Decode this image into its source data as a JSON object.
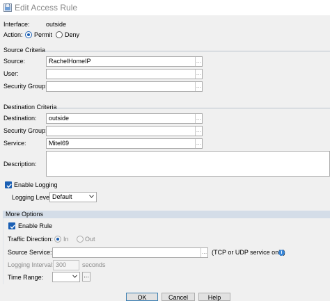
{
  "window": {
    "title": "Edit Access Rule",
    "app_icon": "asdm-shield-icon"
  },
  "interface": {
    "label": "Interface:",
    "value": "outside"
  },
  "action": {
    "label": "Action:",
    "options": [
      "Permit",
      "Deny"
    ],
    "selected": "Permit"
  },
  "source_criteria": {
    "heading": "Source Criteria",
    "source": {
      "label": "Source:",
      "value": "RachelHomeIP"
    },
    "user": {
      "label": "User:",
      "value": ""
    },
    "security_group": {
      "label": "Security Group:",
      "value": ""
    }
  },
  "destination_criteria": {
    "heading": "Destination Criteria",
    "destination": {
      "label": "Destination:",
      "value": "outside"
    },
    "security_group": {
      "label": "Security Group:",
      "value": ""
    },
    "service": {
      "label": "Service:",
      "value": "Mitel69"
    }
  },
  "description": {
    "label": "Description:",
    "value": ""
  },
  "logging": {
    "enable_label": "Enable Logging",
    "enabled": true,
    "level_label": "Logging Level:",
    "level_value": "Default"
  },
  "more_options": {
    "heading": "More Options",
    "enable_rule_label": "Enable Rule",
    "enable_rule": true,
    "traffic_direction": {
      "label": "Traffic Direction:",
      "options": [
        "In",
        "Out"
      ],
      "selected": "In",
      "disabled": true
    },
    "source_service": {
      "label": "Source Service:",
      "value": "",
      "hint": "(TCP or UDP service only)"
    },
    "logging_interval": {
      "label": "Logging Interval:",
      "value": "300",
      "unit": "seconds"
    },
    "time_range": {
      "label": "Time Range:",
      "value": "",
      "browse": "..."
    }
  },
  "buttons": {
    "ok": "OK",
    "cancel": "Cancel",
    "help": "Help"
  },
  "colors": {
    "accent": "#1a5fb4",
    "band": "#d4dde8",
    "info": "#3a86d6"
  }
}
